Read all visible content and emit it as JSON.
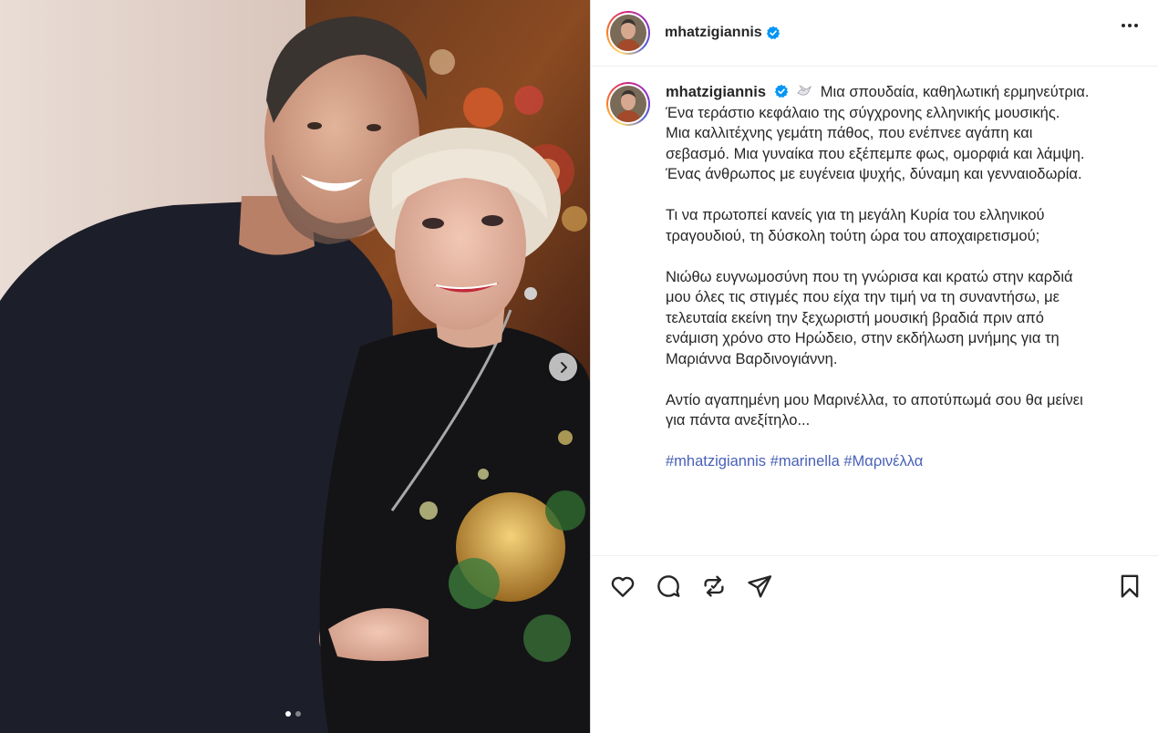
{
  "post": {
    "username": "mhatzigiannis",
    "verified": true,
    "media": {
      "slide_count": 2,
      "current_slide": 1,
      "next_icon": "chevron-right-icon"
    }
  },
  "caption": {
    "username": "mhatzigiannis",
    "emoji": "dove-icon",
    "lines_p1": [
      "Μια σπουδαία, καθηλωτική ερμηνεύτρια.",
      "Ένα τεράστιο κεφάλαιο της σύγχρονης ελληνικής μουσικής.",
      "Μια καλλιτέχνης γεμάτη πάθος, που ενέπνεε αγάπη και",
      "σεβασμό. Μια γυναίκα που εξέπεμπε φως, ομορφιά και λάμψη.",
      "Ένας άνθρωπος με ευγένεια ψυχής, δύναμη και γενναιοδωρία."
    ],
    "lines_p2": [
      "Τι να πρωτοπεί κανείς για τη μεγάλη Κυρία του ελληνικού",
      "τραγουδιού, τη δύσκολη τούτη ώρα του αποχαιρετισμού;"
    ],
    "lines_p3": [
      "Νιώθω ευγνωμοσύνη που τη γνώρισα και κρατώ στην καρδιά",
      "μου όλες τις στιγμές που είχα την τιμή να τη συναντήσω, με",
      "τελευταία εκείνη την ξεχωριστή μουσική βραδιά πριν από",
      "ενάμιση χρόνο στο Ηρώδειο, στην εκδήλωση μνήμης για τη",
      "Μαριάννα Βαρδινογιάννη."
    ],
    "lines_p4": [
      "Αντίο αγαπημένη μου Μαρινέλλα, το αποτύπωμά σου θα μείνει",
      "για πάντα ανεξίτηλο..."
    ],
    "hashtags": [
      "#mhatzigiannis",
      "#marinella",
      "#Μαρινέλλα"
    ]
  },
  "actions": {
    "like_icon": "heart-icon",
    "comment_icon": "comment-icon",
    "repost_icon": "repost-icon",
    "share_icon": "share-icon",
    "save_icon": "bookmark-icon"
  },
  "colors": {
    "accent_blue": "#0095f6",
    "hashtag": "#4861b8",
    "text": "#262626",
    "border": "#dbdbdb"
  }
}
